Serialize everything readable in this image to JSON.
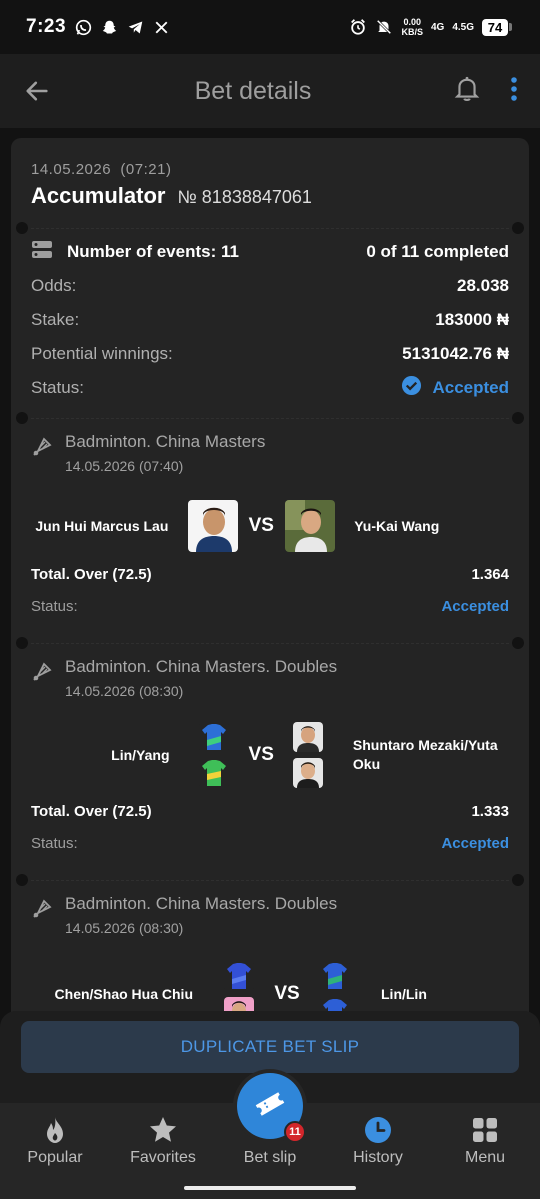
{
  "status_bar": {
    "time": "7:23",
    "net_speed_value": "0.00",
    "net_speed_unit": "KB/S",
    "network_1": "4G",
    "network_2": "4.5G",
    "battery": "74"
  },
  "header": {
    "title": "Bet details"
  },
  "bet": {
    "date": "14.05.2026",
    "time": "(07:21)",
    "type": "Accumulator",
    "number": "№ 81838847061",
    "events_label": "Number of events: 11",
    "completed": "0 of 11 completed",
    "odds_label": "Odds:",
    "odds_value": "28.038",
    "stake_label": "Stake:",
    "stake_value": "183000 ₦",
    "winnings_label": "Potential winnings:",
    "winnings_value": "5131042.76 ₦",
    "status_label": "Status:",
    "status_value": "Accepted"
  },
  "events": [
    {
      "league": "Badminton. China Masters",
      "datetime": "14.05.2026 (07:40)",
      "team1": "Jun Hui Marcus Lau",
      "team2": "Yu-Kai Wang",
      "vs": "VS",
      "market": "Total. Over (72.5)",
      "odds": "1.364",
      "status_label": "Status:",
      "status": "Accepted"
    },
    {
      "league": "Badminton. China Masters. Doubles",
      "datetime": "14.05.2026 (08:30)",
      "team1": "Lin/Yang",
      "team2": "Shuntaro Mezaki/Yuta Oku",
      "vs": "VS",
      "market": "Total. Over (72.5)",
      "odds": "1.333",
      "status_label": "Status:",
      "status": "Accepted"
    },
    {
      "league": "Badminton. China Masters. Doubles",
      "datetime": "14.05.2026 (08:30)",
      "team1": "Chen/Shao Hua Chiu",
      "team2": "Lin/Lin",
      "vs": "VS"
    }
  ],
  "actions": {
    "duplicate": "DUPLICATE BET SLIP"
  },
  "nav": {
    "items": [
      {
        "label": "Popular",
        "icon": "flame-icon"
      },
      {
        "label": "Favorites",
        "icon": "star-icon"
      },
      {
        "label": "Bet slip",
        "icon": "ticket-icon"
      },
      {
        "label": "History",
        "icon": "clock-icon"
      },
      {
        "label": "Menu",
        "icon": "grid-icon"
      }
    ],
    "badge": "11"
  },
  "colors": {
    "accent": "#3b8fe0",
    "background": "#121212",
    "card": "#242424",
    "badge": "#d3262b"
  }
}
